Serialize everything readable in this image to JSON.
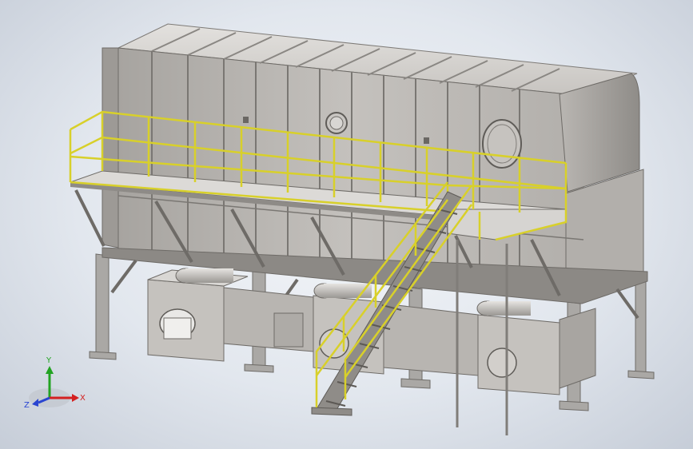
{
  "viewport": {
    "background_top": "#f4f6f9",
    "background_bottom": "#c6cdd8"
  },
  "model": {
    "type": "3D industrial equipment assembly (steel structure with ducts, fans, platform and stairs)",
    "colors": {
      "housing": "#bfbcb8",
      "housing_shadow": "#9e9b97",
      "structure": "#a8a6a3",
      "railing": "#d8d02a",
      "railing_dark": "#a39d18",
      "walkway": "#dcdad7"
    }
  },
  "triad": {
    "x_label": "X",
    "y_label": "Y",
    "z_label": "Z",
    "x_color": "#d42020",
    "y_color": "#22a322",
    "z_color": "#2a45d1"
  }
}
